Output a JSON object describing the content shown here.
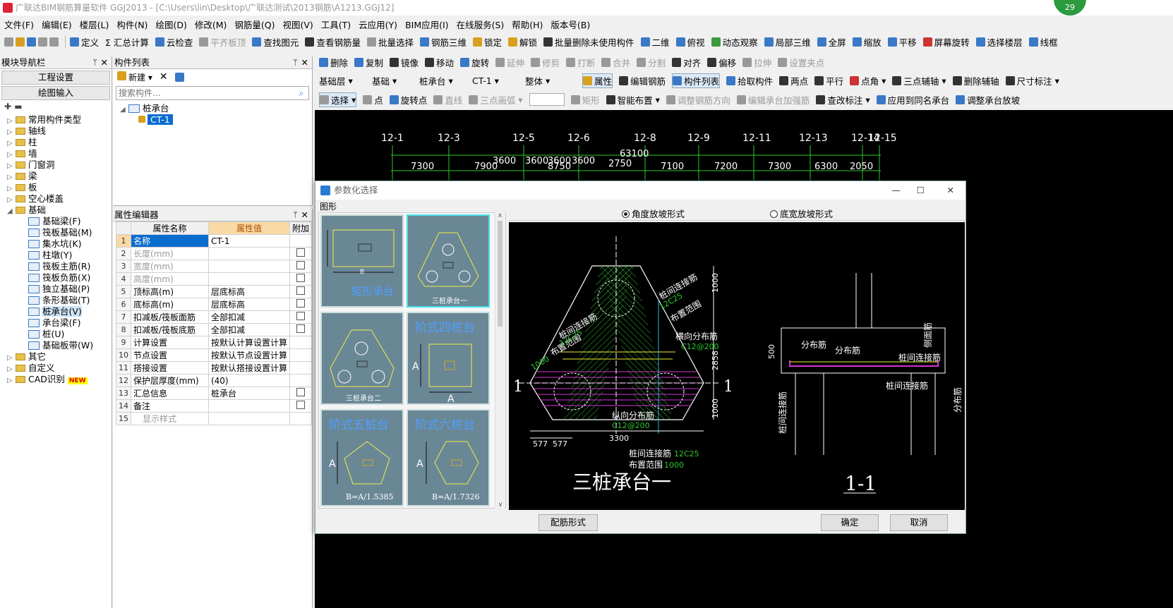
{
  "title": "广联达BIM钢筋算量软件 GGJ2013 - [C:\\Users\\lin\\Desktop\\广联达测试\\2013钢筋\\A1213.GGJ12]",
  "badge": "29",
  "menu": [
    "文件(F)",
    "编辑(E)",
    "楼层(L)",
    "构件(N)",
    "绘图(D)",
    "修改(M)",
    "钢筋量(Q)",
    "视图(V)",
    "工具(T)",
    "云应用(Y)",
    "BIM应用(I)",
    "在线服务(S)",
    "帮助(H)",
    "版本号(B)"
  ],
  "toolbar1": [
    "定义",
    "Σ 汇总计算",
    "云检查",
    "平齐板顶",
    "查找图元",
    "查看钢筋量",
    "批量选择",
    "钢筋三维",
    "锁定",
    "解锁",
    "批量删除未使用构件",
    "二维",
    "俯视",
    "动态观察",
    "局部三维",
    "全屏",
    "缩放",
    "平移",
    "屏幕旋转",
    "选择楼层",
    "线框"
  ],
  "toolbar2": [
    "删除",
    "复制",
    "镜像",
    "移动",
    "旋转",
    "延伸",
    "修剪",
    "打断",
    "合并",
    "分割",
    "对齐",
    "偏移",
    "拉伸",
    "设置夹点"
  ],
  "toolbar3": {
    "floor": "基础层",
    "type": "基础",
    "category": "桩承台",
    "name": "CT-1",
    "scope": "整体",
    "buttons": [
      "属性",
      "编辑钢筋",
      "构件列表",
      "拾取构件",
      "两点",
      "平行",
      "点角",
      "三点辅轴",
      "删除辅轴",
      "尺寸标注"
    ]
  },
  "toolbar4": [
    "选择",
    "点",
    "旋转点",
    "直线",
    "三点画弧",
    "矩形",
    "智能布置",
    "调整钢筋方向",
    "编辑承台加强筋",
    "查改标注",
    "应用到同名承台",
    "调整承台放坡"
  ],
  "left_nav": {
    "title": "模块导航栏",
    "btn1": "工程设置",
    "btn2": "绘图输入",
    "folders": [
      "常用构件类型",
      "轴线",
      "柱",
      "墙",
      "门窗洞",
      "梁",
      "板",
      "空心楼盖",
      "基础"
    ],
    "foundation_items": [
      "基础梁(F)",
      "筏板基础(M)",
      "集水坑(K)",
      "柱墩(Y)",
      "筏板主筋(R)",
      "筏板负筋(X)",
      "独立基础(P)",
      "条形基础(T)",
      "桩承台(V)",
      "承台梁(F)",
      "桩(U)",
      "基础板带(W)"
    ],
    "after": [
      "其它",
      "自定义",
      "CAD识别"
    ],
    "new_tag": "NEW"
  },
  "component_list": {
    "title": "构件列表",
    "new_label": "新建",
    "search_placeholder": "搜索构件...",
    "root": "桩承台",
    "item": "CT-1"
  },
  "prop_editor": {
    "title": "属性编辑器",
    "headers": [
      "属性名称",
      "属性值",
      "附加"
    ],
    "rows": [
      {
        "n": "1",
        "k": "名称",
        "v": "CT-1",
        "cb": false,
        "gray": false
      },
      {
        "n": "2",
        "k": "长度(mm)",
        "v": "",
        "cb": true,
        "gray": true
      },
      {
        "n": "3",
        "k": "宽度(mm)",
        "v": "",
        "cb": true,
        "gray": true
      },
      {
        "n": "4",
        "k": "高度(mm)",
        "v": "",
        "cb": true,
        "gray": true
      },
      {
        "n": "5",
        "k": "顶标高(m)",
        "v": "层底标高",
        "cb": true,
        "gray": false
      },
      {
        "n": "6",
        "k": "底标高(m)",
        "v": "层底标高",
        "cb": true,
        "gray": false
      },
      {
        "n": "7",
        "k": "扣减板/筏板面筋",
        "v": "全部扣减",
        "cb": true,
        "gray": false
      },
      {
        "n": "8",
        "k": "扣减板/筏板底筋",
        "v": "全部扣减",
        "cb": true,
        "gray": false
      },
      {
        "n": "9",
        "k": "计算设置",
        "v": "按默认计算设置计算",
        "cb": false,
        "gray": false
      },
      {
        "n": "10",
        "k": "节点设置",
        "v": "按默认节点设置计算",
        "cb": false,
        "gray": false
      },
      {
        "n": "11",
        "k": "搭接设置",
        "v": "按默认搭接设置计算",
        "cb": false,
        "gray": false
      },
      {
        "n": "12",
        "k": "保护层厚度(mm)",
        "v": "(40)",
        "cb": false,
        "gray": false
      },
      {
        "n": "13",
        "k": "汇总信息",
        "v": "桩承台",
        "cb": true,
        "gray": false
      },
      {
        "n": "14",
        "k": "备注",
        "v": "",
        "cb": true,
        "gray": false
      },
      {
        "n": "15",
        "k": "显示样式",
        "v": "",
        "cb": false,
        "gray": true
      }
    ]
  },
  "axis_labels": [
    "12-1",
    "12-3",
    "12-5",
    "12-6",
    "12-8",
    "12-9",
    "12-11",
    "12-13",
    "12-14",
    "12-15"
  ],
  "dims_top": [
    "63100"
  ],
  "dims_row": [
    "7300",
    "7900",
    "3600",
    "3600",
    "3600",
    "3600",
    "8750",
    "2750",
    "7100",
    "7200",
    "7300",
    "6300",
    "2050"
  ],
  "dialog": {
    "title": "参数化选择",
    "group": "图形",
    "radio1": "角度放坡形式",
    "radio2": "底宽放坡形式",
    "thumbs": [
      "矩形承台",
      "三桩承台一",
      "三桩承台二",
      "阶式四桩台",
      "阶式五桩台",
      "阶式六桩台"
    ],
    "thumb5_formula": "B=A/1.5385",
    "thumb6_formula": "B=A/1.7326",
    "btn_config": "配筋形式",
    "btn_ok": "确定",
    "btn_cancel": "取消",
    "drawing": {
      "title": "三桩承台一",
      "section": "1-1",
      "labels": [
        "桩间连接筋",
        "12C25",
        "布置范围",
        "1000",
        "横向分布筋",
        "C12@200",
        "纵向分布筋",
        "3300",
        "577",
        "2858",
        "1000",
        "1000",
        "分布筋",
        "侧面筋",
        "500",
        "1",
        "1"
      ]
    }
  }
}
